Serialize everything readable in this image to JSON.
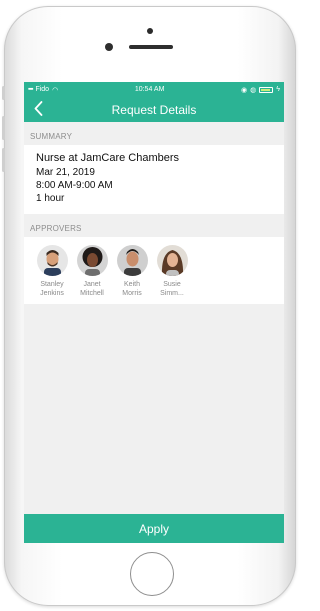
{
  "status_bar": {
    "carrier": "Fido",
    "time": "10:54 AM"
  },
  "nav": {
    "back_icon": "chevron-left-icon",
    "title": "Request Details"
  },
  "summary": {
    "section_label": "SUMMARY",
    "title": "Nurse at JamCare Chambers",
    "date": "Mar 21, 2019",
    "time_range": "8:00 AM-9:00 AM",
    "duration": "1 hour"
  },
  "approvers": {
    "section_label": "APPROVERS",
    "people": [
      {
        "first": "Stanley",
        "last": "Jenkins"
      },
      {
        "first": "Janet",
        "last": "Mitchell"
      },
      {
        "first": "Keith",
        "last": "Morris"
      },
      {
        "first": "Susie",
        "last": "Simm..."
      }
    ]
  },
  "footer": {
    "apply_label": "Apply"
  },
  "colors": {
    "accent": "#2bb394",
    "background": "#f0f0f0"
  }
}
